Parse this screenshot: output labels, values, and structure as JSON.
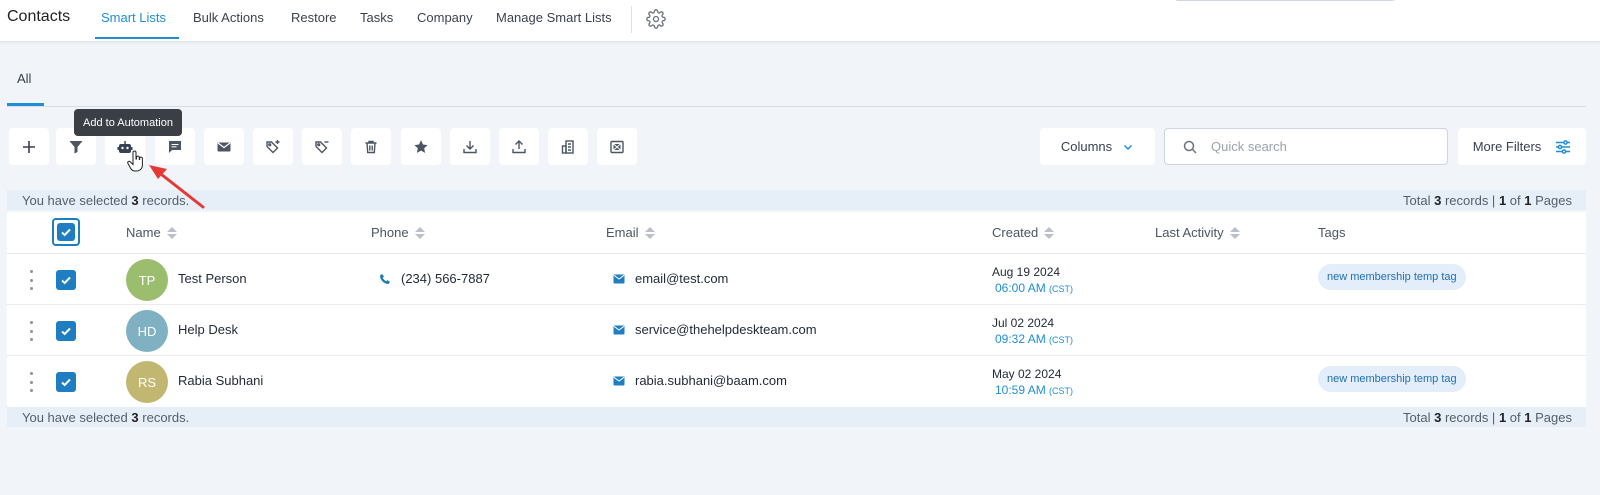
{
  "nav": {
    "title": "Contacts",
    "items": [
      "Smart Lists",
      "Bulk Actions",
      "Restore",
      "Tasks",
      "Company",
      "Manage Smart Lists"
    ],
    "active": "Smart Lists",
    "settings_icon": "gear-icon"
  },
  "tabs": [
    "All"
  ],
  "toolbar": {
    "icons": [
      "plus-icon",
      "filter-icon",
      "robot-icon",
      "message-icon",
      "mail-icon",
      "tag-add-icon",
      "tag-remove-icon",
      "trash-icon",
      "star-icon",
      "download-icon",
      "upload-icon",
      "building-icon",
      "merge-icon"
    ],
    "tooltip": "Add to Automation",
    "columns_label": "Columns",
    "search_placeholder": "Quick search",
    "more_filters_label": "More Filters"
  },
  "selection": {
    "prefix": "You have selected",
    "count": "3",
    "suffix": "records.",
    "total_prefix": "Total",
    "total_count": "3",
    "records_word": "records |",
    "page": "1",
    "of_word": "of",
    "pages": "1",
    "pages_word": "Pages"
  },
  "table": {
    "headers": [
      "Name",
      "Phone",
      "Email",
      "Created",
      "Last Activity",
      "Tags"
    ],
    "rows": [
      {
        "initials": "TP",
        "avatar_color": "#9bbd6e",
        "name": "Test Person",
        "phone": "(234) 566-7887",
        "email": "email@test.com",
        "created_date": "Aug 19 2024",
        "created_time": "06:00 AM",
        "tz": "(CST)",
        "tag": "new membership temp tag"
      },
      {
        "initials": "HD",
        "avatar_color": "#7fb1c2",
        "name": "Help Desk",
        "phone": "",
        "email": "service@thehelpdeskteam.com",
        "created_date": "Jul 02 2024",
        "created_time": "09:32 AM",
        "tz": "(CST)",
        "tag": ""
      },
      {
        "initials": "RS",
        "avatar_color": "#c2b770",
        "name": "Rabia Subhani",
        "phone": "",
        "email": "rabia.subhani@baam.com",
        "created_date": "May 02 2024",
        "created_time": "10:59 AM",
        "tz": "(CST)",
        "tag": "new membership temp tag"
      }
    ]
  },
  "colors": {
    "accent": "#1f8ed6",
    "checkbox": "#1f7dc1",
    "annotation_arrow": "#e53935"
  }
}
